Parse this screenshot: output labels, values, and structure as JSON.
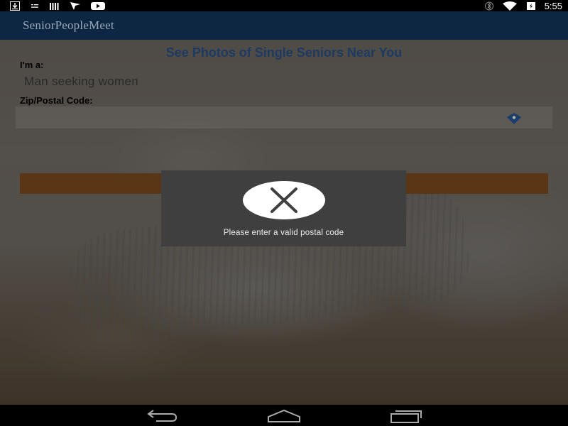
{
  "status_bar": {
    "time": "5:55",
    "left_icons": [
      "download-icon",
      "sim-icon",
      "signal-bars-icon",
      "nav-arrow-icon",
      "youtube-icon"
    ],
    "right_icons": [
      "bluetooth-icon",
      "wifi-icon",
      "battery-icon"
    ]
  },
  "app_bar": {
    "title": "SeniorPeopleMeet",
    "background": "#0d2742"
  },
  "form": {
    "heading": "See Photos of Single Seniors Near You",
    "seeking_label": "I'm a:",
    "seeking_value": "Man seeking women",
    "zip_label": "Zip/Postal Code:",
    "zip_value": "",
    "heading_color": "#1d3a62",
    "button_color": "#5a3616"
  },
  "toast": {
    "icon": "close-x-icon",
    "message": "Please enter a valid postal code"
  },
  "nav_bar": {
    "buttons": [
      "back-icon",
      "home-icon",
      "recents-icon"
    ]
  }
}
